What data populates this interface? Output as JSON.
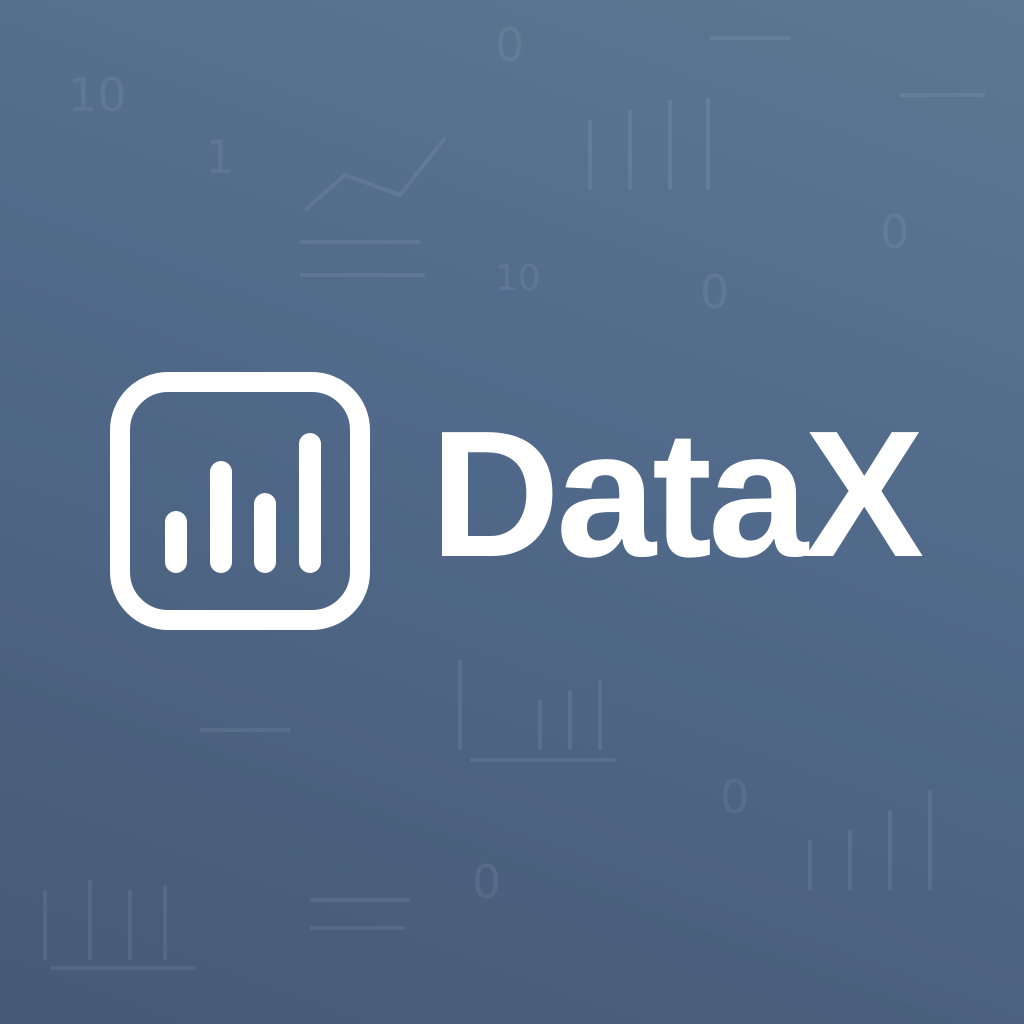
{
  "brand": {
    "name": "DataX",
    "logo_icon": "bar-chart-icon",
    "text_color": "#ffffff",
    "background_colors": [
      "#5c7892",
      "#455a75"
    ]
  },
  "background_marks": [
    "10",
    "1",
    "0",
    "10",
    "0",
    "0",
    "0",
    "0"
  ]
}
